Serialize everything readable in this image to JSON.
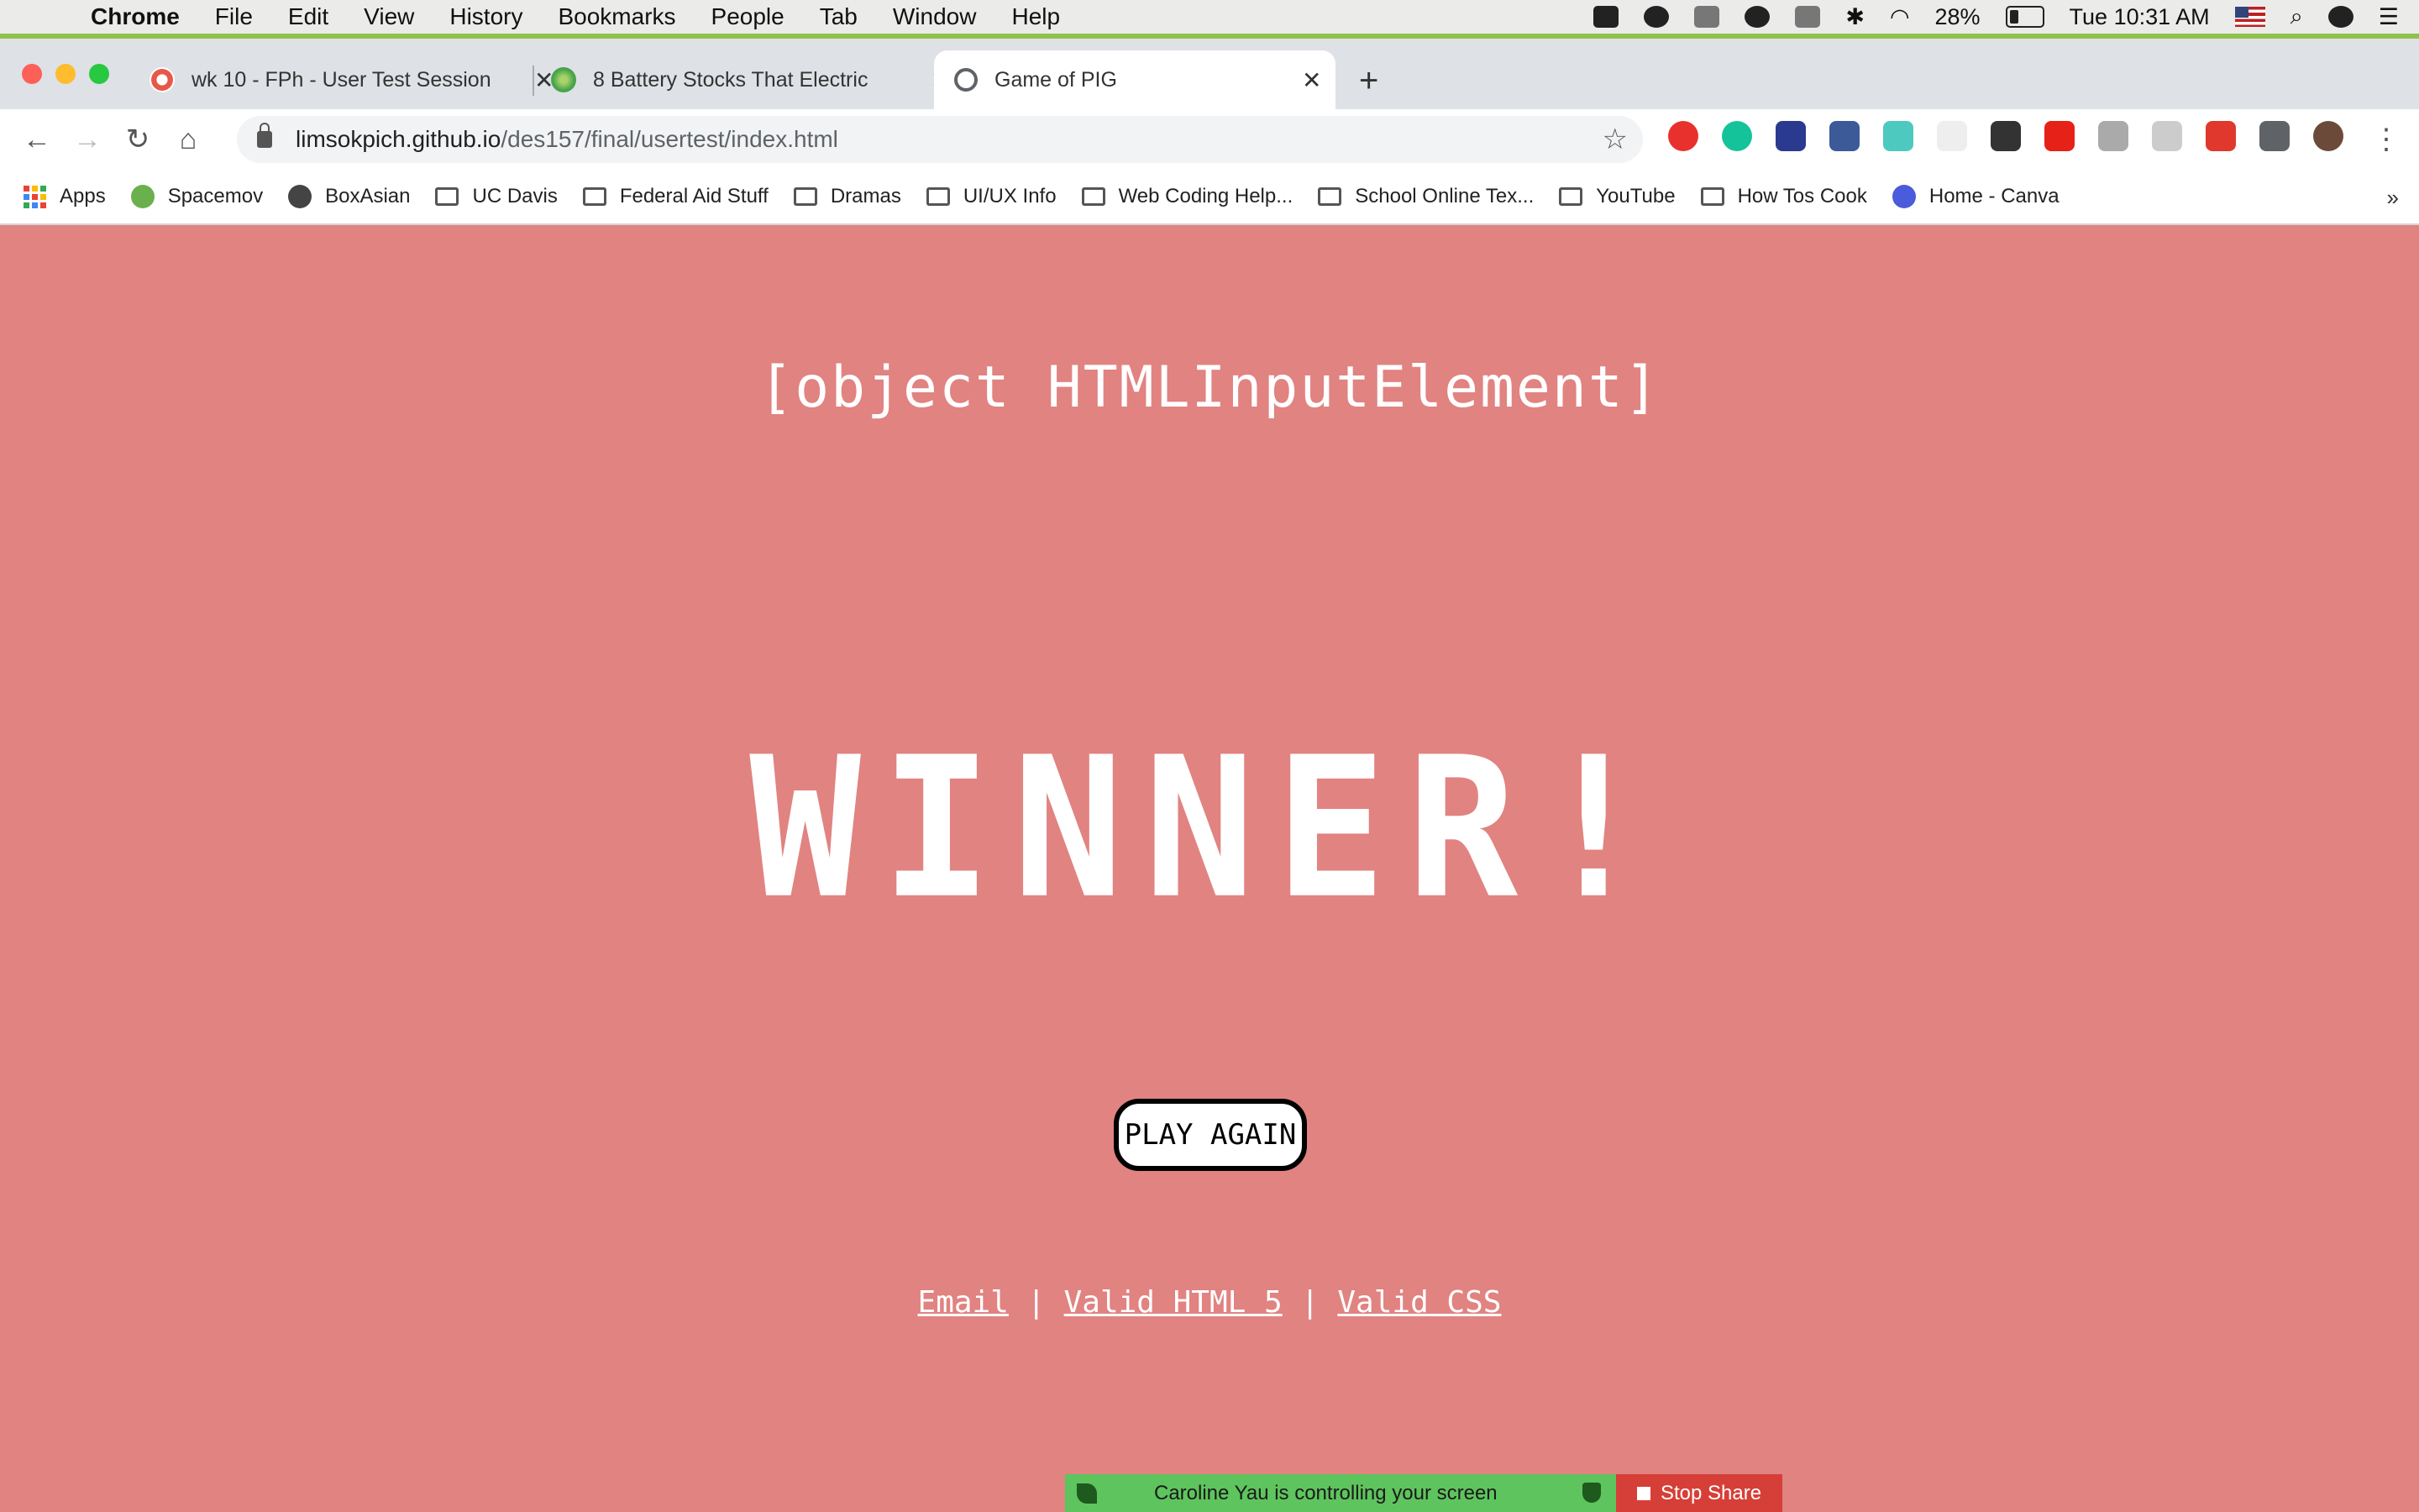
{
  "menubar": {
    "app_name": "Chrome",
    "items": [
      "File",
      "Edit",
      "View",
      "History",
      "Bookmarks",
      "People",
      "Tab",
      "Window",
      "Help"
    ],
    "battery_percent": "28%",
    "clock": "Tue 10:31 AM"
  },
  "tabs": [
    {
      "title": "wk 10 - FPh - User Test Session",
      "favicon_color": "#e8584a"
    },
    {
      "title": "8 Battery Stocks That Electric",
      "favicon_color": "#48a34a"
    },
    {
      "title": "Game of PIG",
      "favicon_color": "#5f6368"
    }
  ],
  "toolbar": {
    "url_host": "limsokpich.github.io",
    "url_path": "/des157/final/usertest/index.html"
  },
  "bookmarks": [
    {
      "label": "Apps",
      "icon": "apps-grid-icon"
    },
    {
      "label": "Spacemov",
      "icon": "play-circle-icon"
    },
    {
      "label": "BoxAsian",
      "icon": "globe-icon"
    },
    {
      "label": "UC Davis",
      "icon": "folder-icon"
    },
    {
      "label": "Federal Aid Stuff",
      "icon": "folder-icon"
    },
    {
      "label": "Dramas",
      "icon": "folder-icon"
    },
    {
      "label": "UI/UX Info",
      "icon": "folder-icon"
    },
    {
      "label": "Web Coding Help...",
      "icon": "folder-icon"
    },
    {
      "label": "School Online Tex...",
      "icon": "folder-icon"
    },
    {
      "label": "YouTube",
      "icon": "folder-icon"
    },
    {
      "label": "How Tos Cook",
      "icon": "folder-icon"
    },
    {
      "label": "Home - Canva",
      "icon": "canva-icon"
    }
  ],
  "page": {
    "player_name": "[object HTMLInputElement]",
    "result": "WINNER!",
    "play_again_label": "PLAY AGAIN",
    "footer": {
      "email_label": "Email",
      "separator": "|",
      "html_label": "Valid HTML 5",
      "css_label": "Valid CSS"
    },
    "background_color": "#e18381"
  },
  "screenshare": {
    "message": "Caroline Yau is controlling your screen",
    "stop_label": "Stop Share"
  }
}
